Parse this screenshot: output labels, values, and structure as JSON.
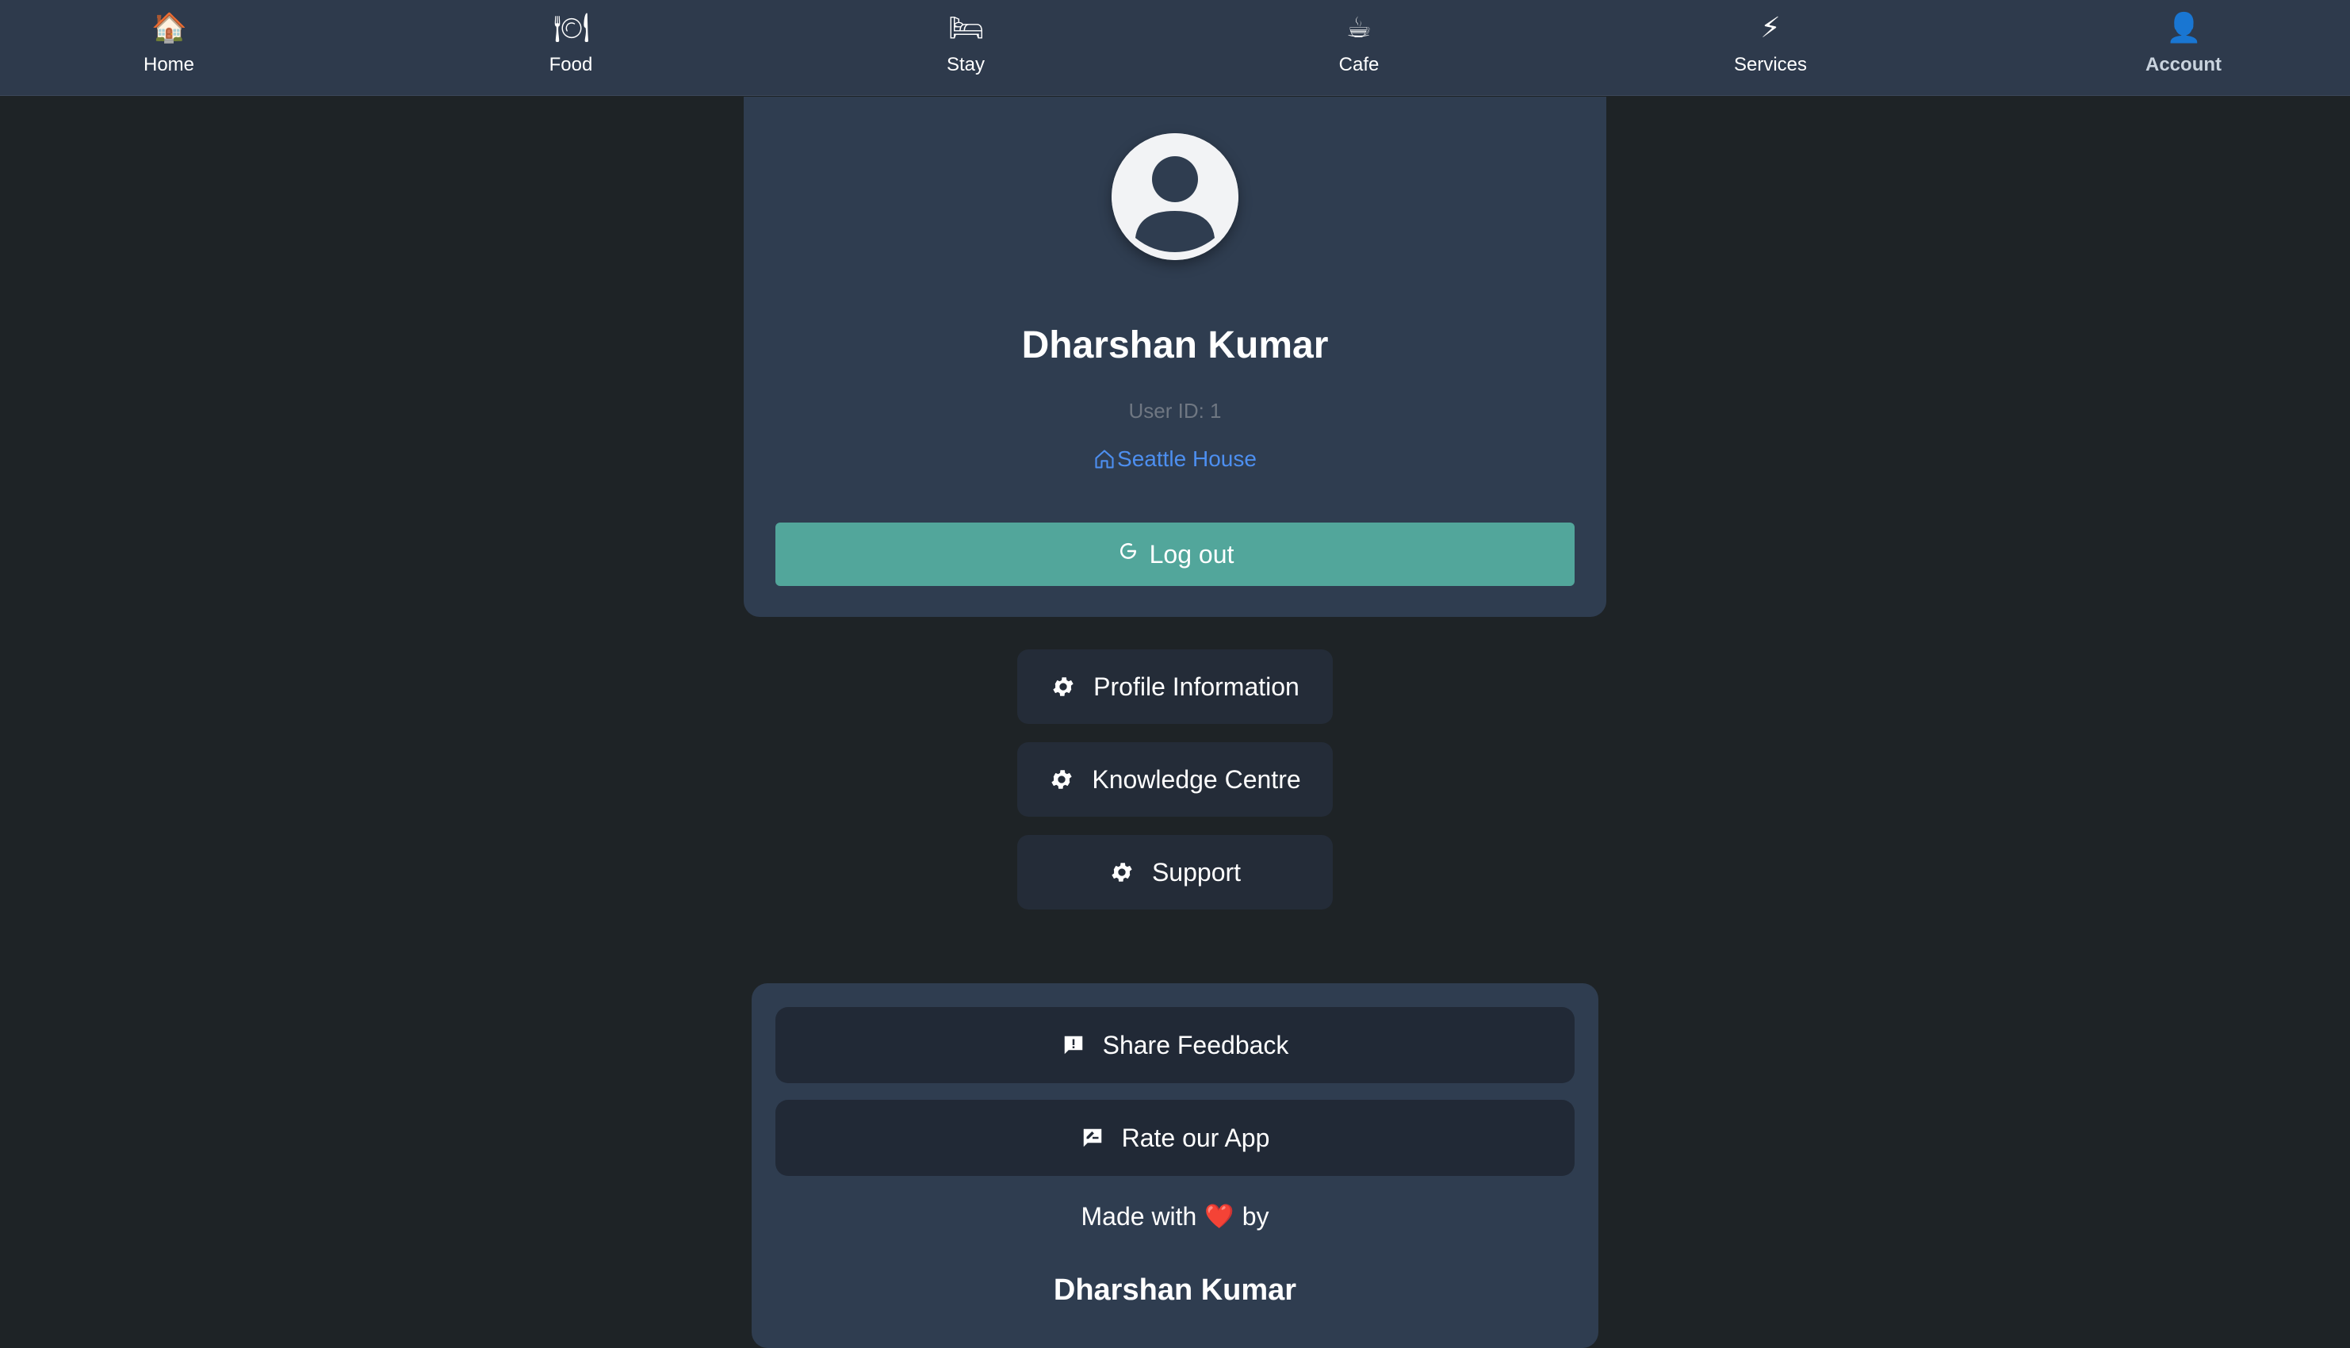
{
  "nav": {
    "items": [
      {
        "label": "Home",
        "icon": "🏠",
        "icon_name": "home-icon"
      },
      {
        "label": "Food",
        "icon": "🍽",
        "icon_name": "plate-icon"
      },
      {
        "label": "Stay",
        "icon": "🛏",
        "icon_name": "bed-icon"
      },
      {
        "label": "Cafe",
        "icon": "☕",
        "icon_name": "coffee-icon"
      },
      {
        "label": "Services",
        "icon": "⚡",
        "icon_name": "lightning-icon"
      },
      {
        "label": "Account",
        "icon": "👤",
        "icon_name": "user-icon"
      }
    ],
    "active": "Account"
  },
  "profile": {
    "name": "Dharshan Kumar",
    "user_id": "User ID: 1",
    "location": "Seattle House",
    "logout_label": "Log out"
  },
  "menu": {
    "items": [
      {
        "label": "Profile Information",
        "icon_name": "gear-icon"
      },
      {
        "label": "Knowledge Centre",
        "icon_name": "gear-icon"
      },
      {
        "label": "Support",
        "icon_name": "gear-icon"
      }
    ]
  },
  "footer": {
    "share_feedback": "Share Feedback",
    "rate_app": "Rate our App",
    "made_with_prefix": "Made with",
    "heart": "❤️",
    "made_with_suffix": "by",
    "author": "Dharshan Kumar"
  },
  "colors": {
    "background": "#1e2326",
    "nav_bg": "#2e3a4c",
    "card_bg": "#2f3d50",
    "accent_teal": "#52a69b",
    "link_blue": "#4d8ff0",
    "pill_bg": "#242c38"
  }
}
